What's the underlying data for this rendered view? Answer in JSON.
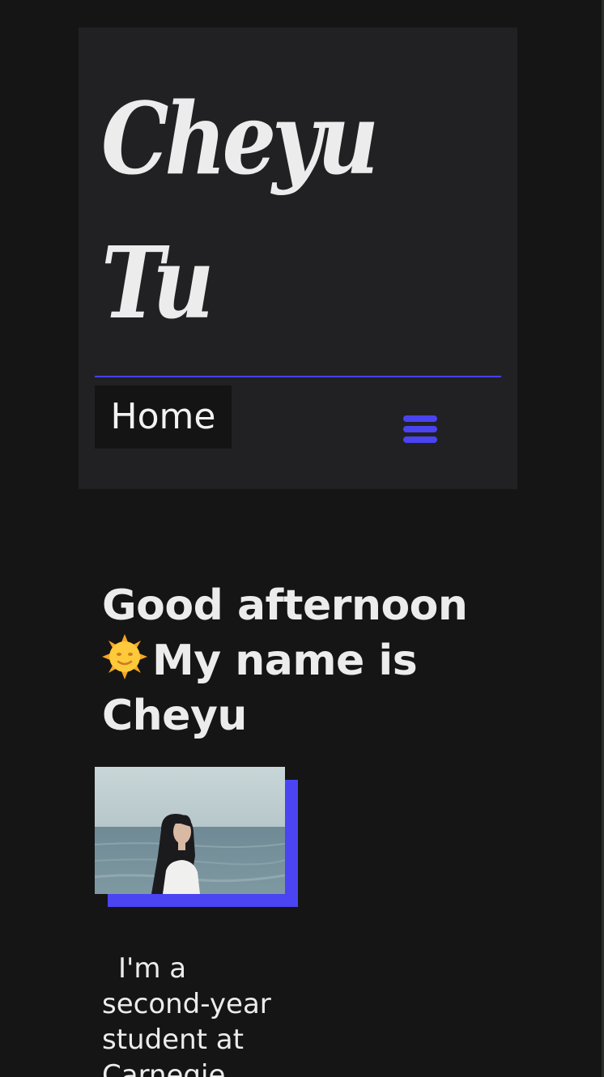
{
  "site": {
    "title": "Cheyu Tu"
  },
  "nav": {
    "home_label": "Home",
    "menu_icon": "hamburger-menu-icon"
  },
  "hero": {
    "greeting_prefix": "Good afternoon",
    "greeting_icon": "sun-face-icon",
    "greeting_suffix": "My name is Cheyu",
    "photo_alt": "Portrait of Cheyu by the sea"
  },
  "bio": {
    "text": "I'm a second-year student at Carnegie"
  },
  "colors": {
    "background": "#151515",
    "header_background": "#212123",
    "accent": "#4a43f0",
    "text": "#ececec"
  }
}
